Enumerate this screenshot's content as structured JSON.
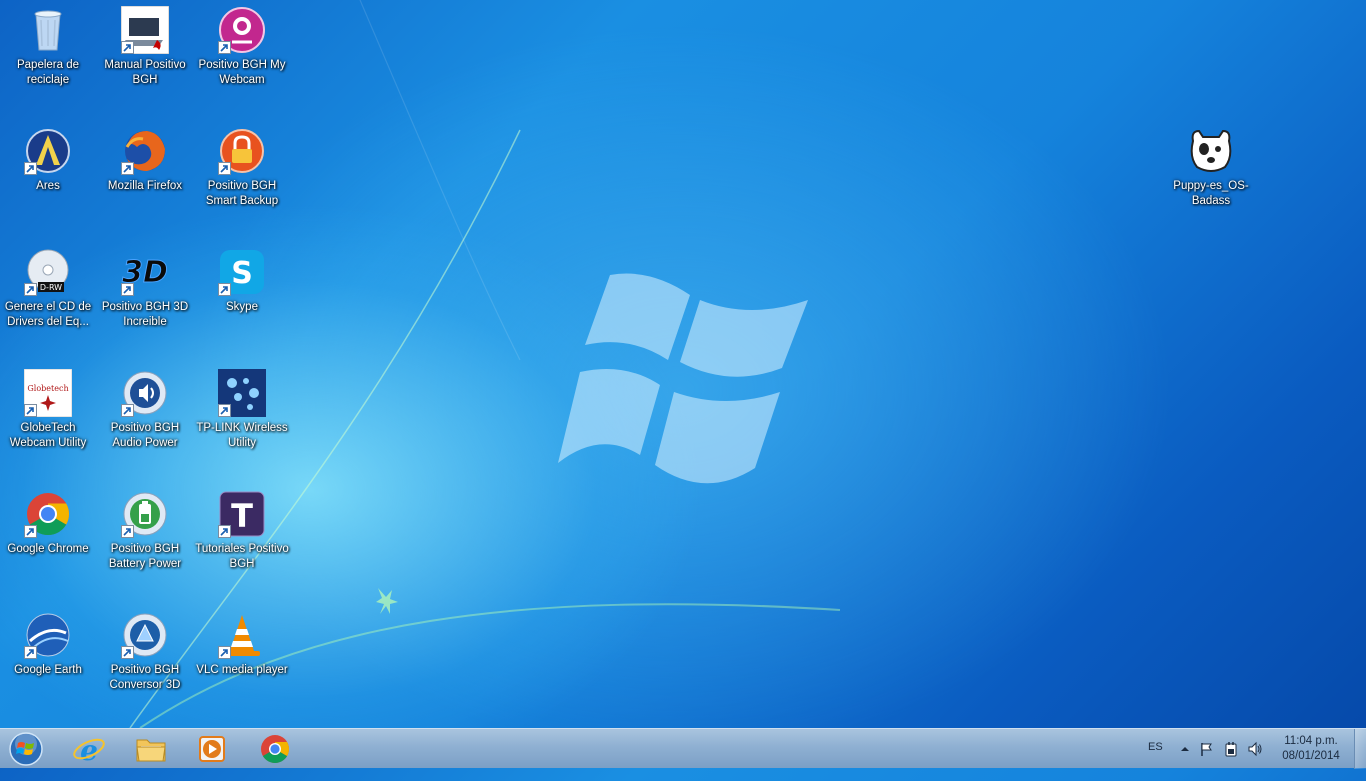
{
  "desktop": {
    "icons": [
      {
        "label": "Papelera de reciclaje",
        "icon": "recycle-bin-icon"
      },
      {
        "label": "Manual Positivo BGH",
        "icon": "pdf-manual-icon"
      },
      {
        "label": "Positivo BGH My Webcam",
        "icon": "webcam-icon"
      },
      {
        "label": "Ares",
        "icon": "ares-icon"
      },
      {
        "label": "Mozilla Firefox",
        "icon": "firefox-icon"
      },
      {
        "label": "Positivo BGH Smart Backup",
        "icon": "backup-lock-icon"
      },
      {
        "label": "Genere el CD de Drivers del  Eq...",
        "icon": "cd-drw-icon"
      },
      {
        "label": "Positivo BGH 3D Increible",
        "icon": "3d-icon"
      },
      {
        "label": "Skype",
        "icon": "skype-icon"
      },
      {
        "label": "GlobeTech Webcam Utility",
        "icon": "globetech-icon"
      },
      {
        "label": "Positivo BGH Audio Power",
        "icon": "audio-power-icon"
      },
      {
        "label": "TP-LINK Wireless Utility",
        "icon": "tplink-wireless-icon"
      },
      {
        "label": "Google Chrome",
        "icon": "chrome-icon"
      },
      {
        "label": "Positivo BGH Battery Power",
        "icon": "battery-power-icon"
      },
      {
        "label": "Tutoriales Positivo BGH",
        "icon": "tutoriales-icon"
      },
      {
        "label": "Google Earth",
        "icon": "google-earth-icon"
      },
      {
        "label": "Positivo BGH Conversor 3D",
        "icon": "conversor-3d-icon"
      },
      {
        "label": "VLC media player",
        "icon": "vlc-icon"
      },
      {
        "label": "Puppy-es_OS-Badass",
        "icon": "puppy-icon"
      }
    ]
  },
  "taskbar": {
    "apps": [
      {
        "name": "Internet Explorer",
        "icon": "internet-explorer-icon"
      },
      {
        "name": "Windows Explorer",
        "icon": "folder-icon"
      },
      {
        "name": "Windows Media Player",
        "icon": "media-player-icon"
      },
      {
        "name": "Google Chrome",
        "icon": "chrome-icon"
      }
    ],
    "tray": {
      "language": "ES",
      "time": "11:04 p.m.",
      "date": "08/01/2014"
    }
  },
  "colors": {
    "taskbar": "#8fb0d2",
    "desktop_blue": "#1583dc"
  }
}
